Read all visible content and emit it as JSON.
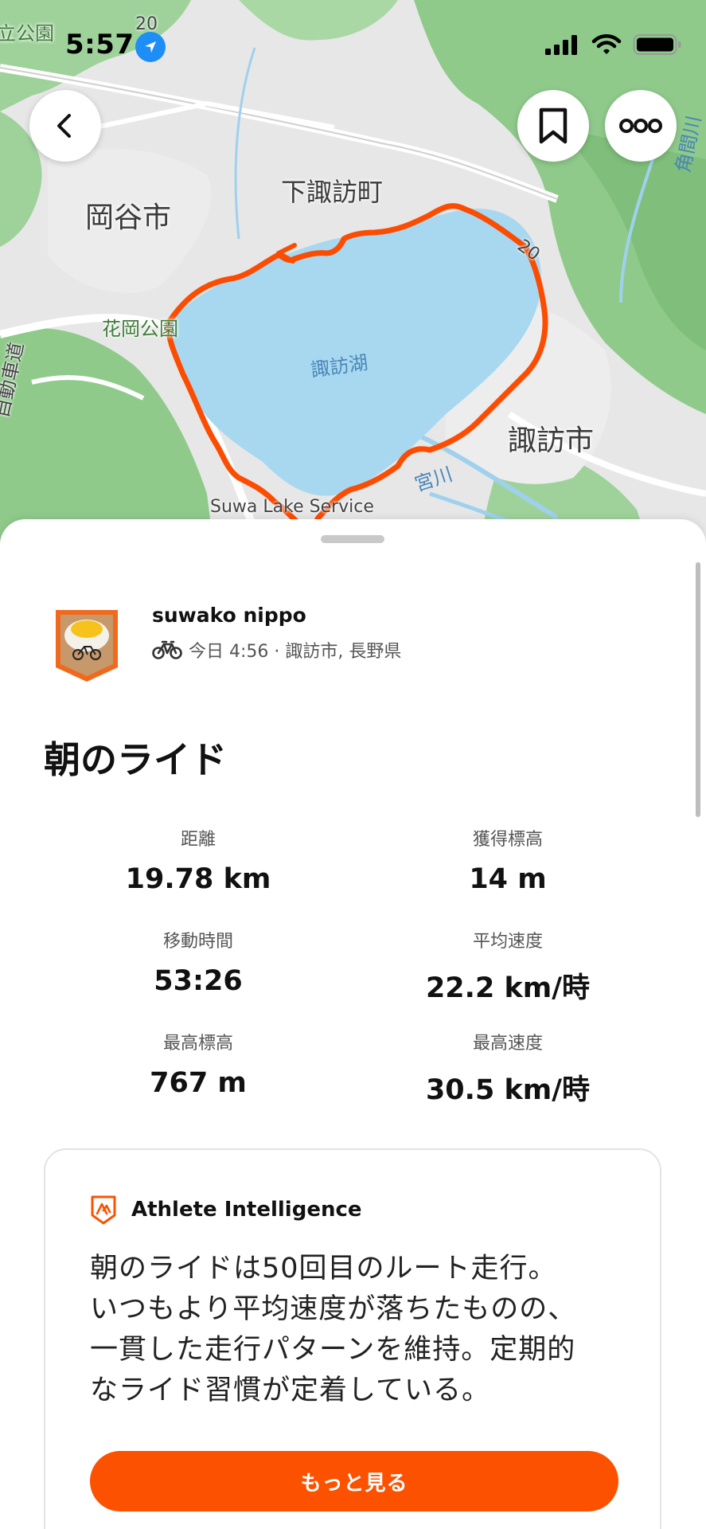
{
  "status_bar": {
    "time": "5:57"
  },
  "map": {
    "labels": {
      "top_left_park": "立公園",
      "road_top": "20",
      "city_okaya": "岡谷市",
      "town_shimosuwa": "下諏訪町",
      "park_hanaoka": "花岡公園",
      "lake": "諏訪湖",
      "road_right": "20",
      "city_suwa": "諏訪市",
      "river_miyagawa": "宮川",
      "river_kakuma": "角間川",
      "expressway": "自動車道",
      "service_area": "Suwa Lake Service"
    }
  },
  "activity": {
    "athlete_name": "suwako nippo",
    "meta": "今日 4:56 · 諏訪市, 長野県",
    "title": "朝のライド",
    "stats": [
      {
        "label": "距離",
        "value": "19.78 km"
      },
      {
        "label": "獲得標高",
        "value": "14 m"
      },
      {
        "label": "移動時間",
        "value": "53:26"
      },
      {
        "label": "平均速度",
        "value": "22.2 km/時"
      },
      {
        "label": "最高標高",
        "value": "767 m"
      },
      {
        "label": "最高速度",
        "value": "30.5 km/時"
      }
    ]
  },
  "ai_card": {
    "title": "Athlete Intelligence",
    "body_lines": [
      "朝のライドは50回目のルート走行。",
      "いつもより平均速度が落ちたものの、",
      "一貫した走行パターンを維持。定期的",
      "なライド習慣が定着している。"
    ],
    "button_label": "もっと見る"
  },
  "colors": {
    "accent": "#fc5200",
    "route": "#fc4c02",
    "lake": "#a8d8f0",
    "park_green": "#8cc98a",
    "location_blue": "#1e8ef7"
  },
  "icons": [
    "location-arrow-icon",
    "signal-icon",
    "wifi-icon",
    "battery-icon",
    "back-chevron-icon",
    "bookmark-icon",
    "more-dots-icon",
    "bike-icon",
    "athlete-intelligence-icon"
  ]
}
